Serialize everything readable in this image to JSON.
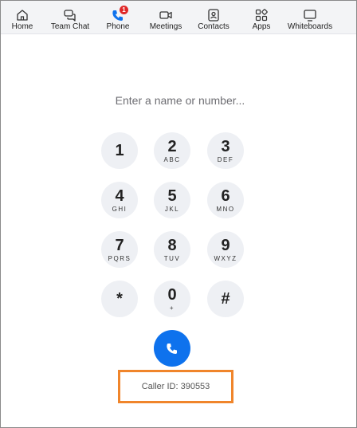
{
  "nav": {
    "items": [
      {
        "label": "Home",
        "icon": "home-icon"
      },
      {
        "label": "Team Chat",
        "icon": "chat-icon"
      },
      {
        "label": "Phone",
        "icon": "phone-icon",
        "badge": "1"
      },
      {
        "label": "Meetings",
        "icon": "video-icon"
      },
      {
        "label": "Contacts",
        "icon": "contacts-icon"
      },
      {
        "label": "Apps",
        "icon": "apps-icon"
      },
      {
        "label": "Whiteboards",
        "icon": "whiteboard-icon"
      }
    ],
    "active": "Phone"
  },
  "dialer": {
    "placeholder": "Enter a name or number...",
    "keys": [
      {
        "digit": "1",
        "letters": ""
      },
      {
        "digit": "2",
        "letters": "ABC"
      },
      {
        "digit": "3",
        "letters": "DEF"
      },
      {
        "digit": "4",
        "letters": "GHI"
      },
      {
        "digit": "5",
        "letters": "JKL"
      },
      {
        "digit": "6",
        "letters": "MNO"
      },
      {
        "digit": "7",
        "letters": "PQRS"
      },
      {
        "digit": "8",
        "letters": "TUV"
      },
      {
        "digit": "9",
        "letters": "WXYZ"
      },
      {
        "digit": "*",
        "letters": ""
      },
      {
        "digit": "0",
        "letters": "+"
      },
      {
        "digit": "#",
        "letters": ""
      }
    ],
    "caller_id": "Caller ID: 390553"
  },
  "colors": {
    "call_button": "#0e72ed",
    "badge": "#e02828",
    "highlight_border": "#f0852b",
    "active_icon": "#0e72ed"
  }
}
